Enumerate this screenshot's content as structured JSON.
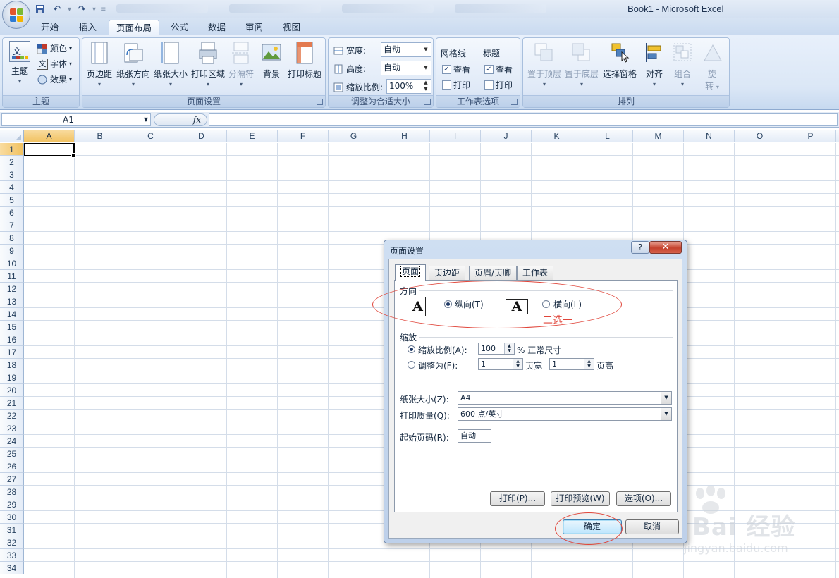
{
  "window": {
    "title": "Book1 - Microsoft Excel"
  },
  "ribbon_tabs": [
    {
      "label": "开始",
      "active": false
    },
    {
      "label": "插入",
      "active": false
    },
    {
      "label": "页面布局",
      "active": true
    },
    {
      "label": "公式",
      "active": false
    },
    {
      "label": "数据",
      "active": false
    },
    {
      "label": "审阅",
      "active": false
    },
    {
      "label": "视图",
      "active": false
    }
  ],
  "groups": {
    "theme": {
      "label": "主题",
      "theme_button": "主题",
      "colors": "颜色",
      "fonts": "字体",
      "effects": "效果"
    },
    "page_setup": {
      "label": "页面设置",
      "buttons": [
        "页边距",
        "纸张方向",
        "纸张大小",
        "打印区域",
        "分隔符",
        "背景",
        "打印标题"
      ]
    },
    "scale_to_fit": {
      "label": "调整为合适大小",
      "width_label": "宽度:",
      "width_value": "自动",
      "height_label": "高度:",
      "height_value": "自动",
      "scale_label": "缩放比例:",
      "scale_value": "100%"
    },
    "sheet_options": {
      "label": "工作表选项",
      "gridlines": "网格线",
      "headings": "标题",
      "view": "查看",
      "print": "打印"
    },
    "arrange": {
      "label": "排列",
      "buttons": [
        "置于顶层",
        "置于底层",
        "选择窗格",
        "对齐",
        "组合",
        "旋",
        "转"
      ]
    }
  },
  "formula_bar": {
    "name_box": "A1",
    "fx": "fx"
  },
  "columns": [
    "A",
    "B",
    "C",
    "D",
    "E",
    "F",
    "G",
    "H",
    "I",
    "J",
    "K",
    "L",
    "M",
    "N",
    "O",
    "P"
  ],
  "rows": [
    "1",
    "2",
    "3",
    "4",
    "5",
    "6",
    "7",
    "8",
    "9",
    "10",
    "11",
    "12",
    "13",
    "14",
    "15",
    "16",
    "17",
    "18",
    "19",
    "20",
    "21",
    "22",
    "23",
    "24",
    "25",
    "26",
    "27",
    "28",
    "29",
    "30",
    "31",
    "32",
    "33",
    "34"
  ],
  "dialog": {
    "title": "页面设置",
    "help": "?",
    "close": "✕",
    "tabs": [
      "页面",
      "页边距",
      "页眉/页脚",
      "工作表"
    ],
    "orientation": {
      "section": "方向",
      "portrait": "纵向(T)",
      "landscape": "横向(L)",
      "icon_glyph": "A"
    },
    "scaling": {
      "section": "缩放",
      "adjust_to": "缩放比例(A):",
      "adjust_value": "100",
      "normal_size": "% 正常尺寸",
      "fit_to": "调整为(F):",
      "fit_wide_value": "1",
      "pages_wide": "页宽",
      "fit_tall_value": "1",
      "pages_tall": "页高"
    },
    "paper_size_label": "纸张大小(Z):",
    "paper_size_value": "A4",
    "print_quality_label": "打印质量(Q):",
    "print_quality_value": "600 点/英寸",
    "first_page_label": "起始页码(R):",
    "first_page_value": "自动",
    "buttons": {
      "print": "打印(P)...",
      "preview": "打印预览(W)",
      "options": "选项(O)...",
      "ok": "确定",
      "cancel": "取消"
    }
  },
  "annotation": {
    "text": "二选一",
    "color": "#e0453a"
  },
  "watermark": {
    "main": "Bai 经验",
    "sub": "jingyan.baidu.com"
  },
  "colors": {
    "accent": "#2b579a",
    "selected_header": "#f1c15f",
    "annotation": "#e0453a"
  }
}
